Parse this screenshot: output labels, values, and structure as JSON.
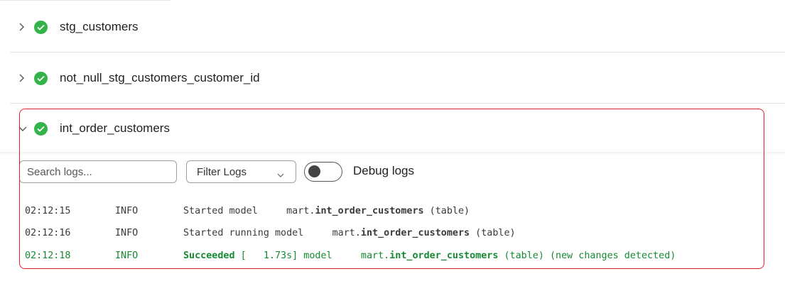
{
  "nodes": [
    {
      "label": "stg_customers",
      "expanded": false,
      "status": "success"
    },
    {
      "label": "not_null_stg_customers_customer_id",
      "expanded": false,
      "status": "success"
    },
    {
      "label": "int_order_customers",
      "expanded": true,
      "status": "success"
    }
  ],
  "log_controls": {
    "search_placeholder": "Search logs...",
    "filter_label": "Filter Logs",
    "debug_label": "Debug logs",
    "debug_enabled": false
  },
  "logs": [
    {
      "time": "02:12:15",
      "level": "INFO",
      "pre": "Started model     mart.",
      "model": "int_order_customers",
      "post": " (table)"
    },
    {
      "time": "02:12:16",
      "level": "INFO",
      "pre": "Started running model     mart.",
      "model": "int_order_customers",
      "post": " (table)"
    },
    {
      "time": "02:12:18",
      "level": "INFO",
      "pre_bold": "Succeeded",
      "pre": " [   1.73s] model     mart.",
      "model": "int_order_customers",
      "post": " (table) (new changes detected)"
    }
  ],
  "colors": {
    "success": "#33b34a",
    "success_log": "#168a33",
    "highlight": "#e0202a"
  }
}
